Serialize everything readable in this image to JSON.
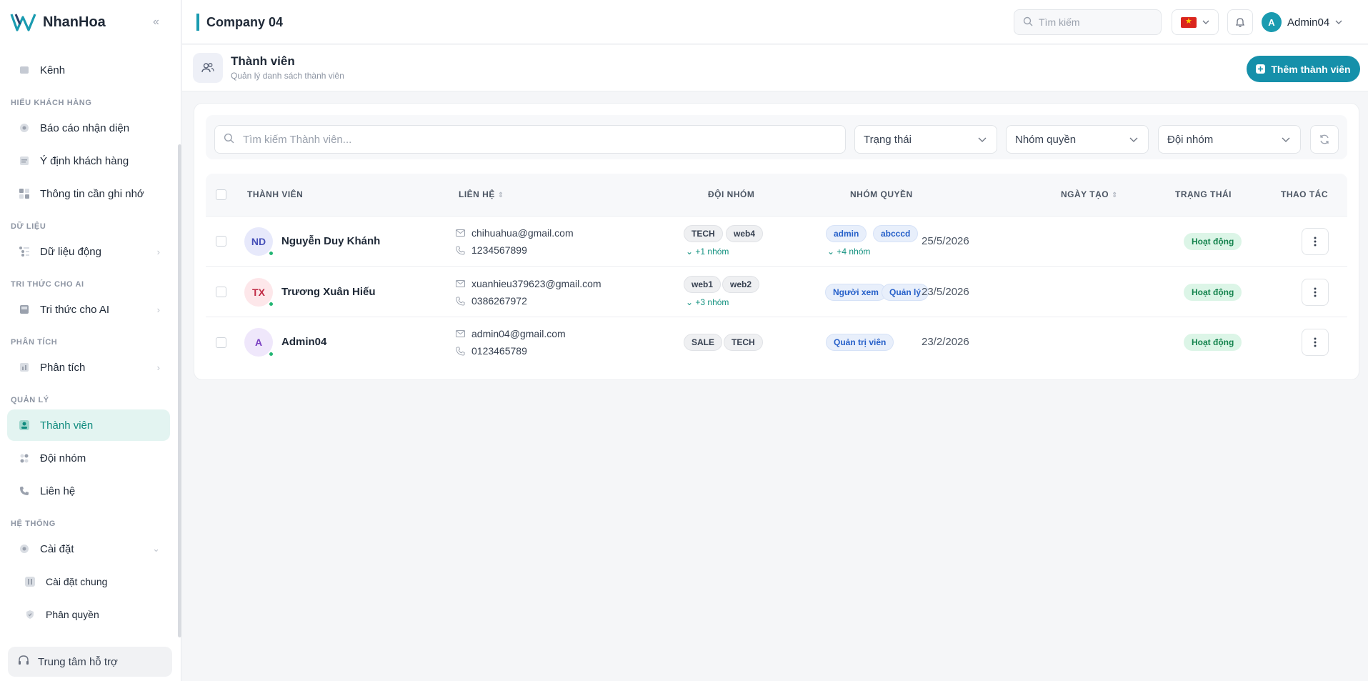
{
  "brand": {
    "name": "NhanHoa"
  },
  "sidebar": {
    "items": [
      {
        "label": "Kênh"
      },
      {
        "section": "HIỂU KHÁCH HÀNG"
      },
      {
        "label": "Báo cáo nhận diện"
      },
      {
        "label": "Ý định khách hàng"
      },
      {
        "label": "Thông tin cần ghi nhớ"
      },
      {
        "section": "DỮ LIỆU"
      },
      {
        "label": "Dữ liệu động"
      },
      {
        "section": "TRI THỨC CHO AI"
      },
      {
        "label": "Tri thức cho AI"
      },
      {
        "section": "PHÂN TÍCH"
      },
      {
        "label": "Phân tích"
      },
      {
        "section": "QUẢN LÝ"
      },
      {
        "label": "Thành viên"
      },
      {
        "label": "Đội nhóm"
      },
      {
        "label": "Liên hệ"
      },
      {
        "section": "HỆ THỐNG"
      },
      {
        "label": "Cài đặt"
      },
      {
        "label": "Cài đặt chung"
      },
      {
        "label": "Phân quyền"
      }
    ],
    "help": "Trung tâm hỗ trợ"
  },
  "topbar": {
    "company": "Company 04",
    "search_placeholder": "Tìm kiếm",
    "user_initial": "A",
    "user_name": "Admin04"
  },
  "page": {
    "title": "Thành viên",
    "subtitle": "Quản lý danh sách thành viên",
    "add_button": "Thêm thành viên"
  },
  "filters": {
    "search_placeholder": "Tìm kiếm Thành viên...",
    "status": "Trạng thái",
    "role_group": "Nhóm quyền",
    "team": "Đội nhóm"
  },
  "table": {
    "headers": {
      "member": "THÀNH VIÊN",
      "contact": "LIÊN HỆ",
      "team": "ĐỘI NHÓM",
      "roles": "NHÓM QUYỀN",
      "created": "NGÀY TẠO",
      "status": "TRẠNG THÁI",
      "actions": "THAO TÁC"
    },
    "rows": [
      {
        "initials": "ND",
        "name": "Nguyễn Duy Khánh",
        "email": "chihuahua@gmail.com",
        "phone": "1234567899",
        "teams": [
          "TECH",
          "web4"
        ],
        "teams_more": "+1 nhóm",
        "roles": [
          "admin",
          "abcccd"
        ],
        "roles_more": "+4 nhóm",
        "date": "25/5/2026",
        "status": "Hoạt động"
      },
      {
        "initials": "TX",
        "name": "Trương Xuân Hiếu",
        "email": "xuanhieu379623@gmail.com",
        "phone": "0386267972",
        "teams": [
          "web1",
          "web2"
        ],
        "teams_more": "+3 nhóm",
        "roles": [
          "Người xem",
          "Quản lý"
        ],
        "roles_more": "",
        "date": "23/5/2026",
        "status": "Hoạt động"
      },
      {
        "initials": "A",
        "name": "Admin04",
        "email": "admin04@gmail.com",
        "phone": "0123465789",
        "teams": [
          "SALE",
          "TECH"
        ],
        "teams_more": "",
        "roles": [
          "Quản trị viên"
        ],
        "roles_more": "",
        "date": "23/2/2026",
        "status": "Hoạt động"
      }
    ]
  },
  "colors": {
    "accent": "#1590aa",
    "active_bg": "#e3f4f1",
    "status_green": "#14834d"
  }
}
